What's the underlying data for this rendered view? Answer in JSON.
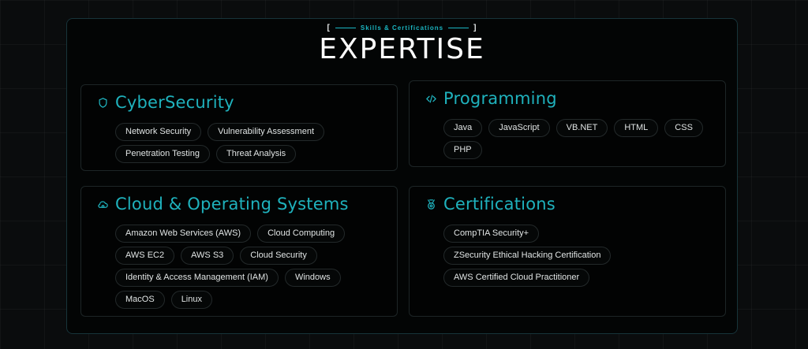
{
  "header": {
    "eyebrow": "Skills & Certifications",
    "bracket_left": "[",
    "bracket_right": "]",
    "title": "EXPERTISE"
  },
  "cards": {
    "cyber": {
      "title": "CyberSecurity",
      "icon": "shield-icon",
      "tags": [
        "Network Security",
        "Vulnerability Assessment",
        "Penetration Testing",
        "Threat Analysis"
      ]
    },
    "programming": {
      "title": "Programming",
      "icon": "code-icon",
      "tags": [
        "Java",
        "JavaScript",
        "VB.NET",
        "HTML",
        "CSS",
        "PHP"
      ]
    },
    "cloud": {
      "title": "Cloud & Operating Systems",
      "icon": "cloud-icon",
      "tags": [
        "Amazon Web Services (AWS)",
        "Cloud Computing",
        "AWS EC2",
        "AWS S3",
        "Cloud Security",
        "Identity & Access Management (IAM)",
        "Windows",
        "MacOS",
        "Linux"
      ]
    },
    "certs": {
      "title": "Certifications",
      "icon": "badge-icon",
      "tags": [
        "CompTIA Security+",
        "ZSecurity Ethical Hacking Certification",
        "AWS Certified Cloud Practitioner"
      ]
    }
  },
  "colors": {
    "accent": "#1fb2bd",
    "background": "#0a0c0d",
    "card_border": "#1d2526"
  }
}
